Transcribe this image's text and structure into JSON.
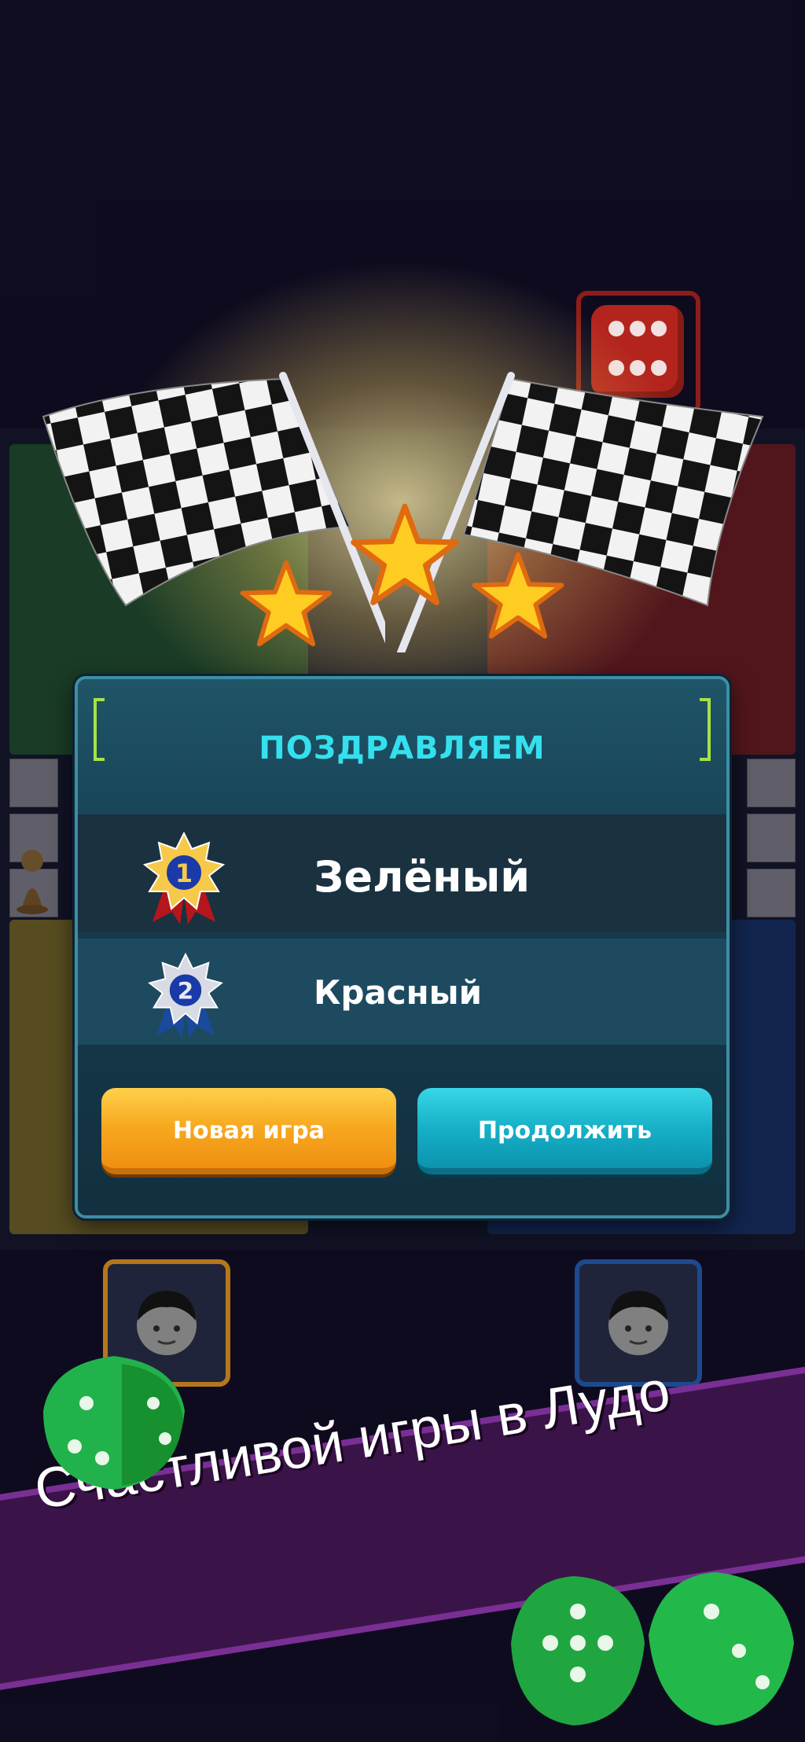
{
  "dialog": {
    "title": "ПОЗДРАВЛЯЕМ",
    "results": [
      {
        "place": "1",
        "name": "Зелёный"
      },
      {
        "place": "2",
        "name": "Красный"
      }
    ],
    "buttons": {
      "new_game": "Новая игра",
      "continue": "Продолжить"
    }
  },
  "banner": {
    "text": "Счастливой игры в Лудо"
  },
  "colors": {
    "title": "#35e0ee",
    "new_game_button": "#f7a71e",
    "continue_button": "#16b0c8",
    "banner": "#3a1448"
  },
  "icons": {
    "flags": "checkered-flag-icon",
    "stars": "star-icon",
    "dice": "dice-icon",
    "avatar": "player-avatar-icon",
    "medal": "medal-icon"
  }
}
